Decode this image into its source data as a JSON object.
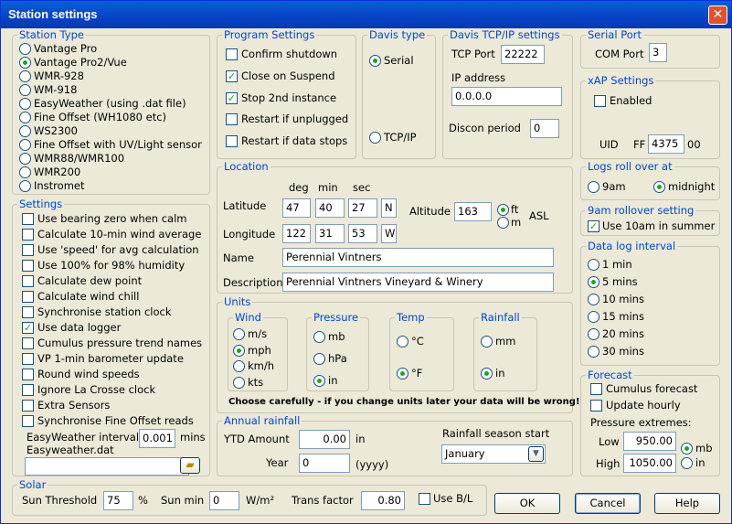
{
  "window": {
    "title": "Station settings",
    "close_glyph": "✕"
  },
  "station_type": {
    "legend": "Station Type",
    "options": [
      "Vantage Pro",
      "Vantage Pro2/Vue",
      "WMR-928",
      "WM-918",
      "EasyWeather (using .dat file)",
      "Fine Offset (WH1080 etc)",
      "WS2300",
      "Fine Offset with UV/Light sensor",
      "WMR88/WMR100",
      "WMR200",
      "Instromet"
    ],
    "selected": 1
  },
  "settings": {
    "legend": "Settings",
    "items": [
      {
        "label": "Use bearing zero when calm",
        "checked": false
      },
      {
        "label": "Calculate 10-min wind average",
        "checked": false
      },
      {
        "label": "Use 'speed' for avg calculation",
        "checked": false
      },
      {
        "label": "Use 100% for 98% humidity",
        "checked": false
      },
      {
        "label": "Calculate dew point",
        "checked": false
      },
      {
        "label": "Calculate wind chill",
        "checked": false
      },
      {
        "label": "Synchronise station clock",
        "checked": false
      },
      {
        "label": "Use data logger",
        "checked": true
      },
      {
        "label": "Cumulus pressure trend names",
        "checked": false
      },
      {
        "label": "VP 1-min barometer update",
        "checked": false
      },
      {
        "label": "Round wind speeds",
        "checked": false
      },
      {
        "label": "Ignore La Crosse clock",
        "checked": false
      },
      {
        "label": "Extra Sensors",
        "checked": false
      },
      {
        "label": "Synchronise Fine Offset reads",
        "checked": false
      }
    ],
    "easyweather_label": "EasyWeather interval",
    "easyweather_value": "0.001",
    "mins": "mins",
    "dat_label": "Easyweather.dat",
    "dat_value": ""
  },
  "program": {
    "legend": "Program Settings",
    "items": [
      {
        "label": "Confirm shutdown",
        "checked": false
      },
      {
        "label": "Close on Suspend",
        "checked": true
      },
      {
        "label": "Stop 2nd instance",
        "checked": true
      },
      {
        "label": "Restart if unplugged",
        "checked": false
      },
      {
        "label": "Restart if data stops",
        "checked": false
      }
    ]
  },
  "davis_type": {
    "legend": "Davis type",
    "serial": "Serial",
    "tcpip": "TCP/IP",
    "selected": "serial"
  },
  "davis_tcp": {
    "legend": "Davis TCP/IP settings",
    "tcp_port_label": "TCP Port",
    "tcp_port": "22222",
    "ip_label": "IP address",
    "ip": "0.0.0.0",
    "discon_label": "Discon period",
    "discon": "0"
  },
  "serial_port": {
    "legend": "Serial Port",
    "com_label": "COM Port",
    "com": "3"
  },
  "xap": {
    "legend": "xAP Settings",
    "enabled_label": "Enabled",
    "enabled": false,
    "uid_label": "UID",
    "ff": "FF",
    "uid": "4375",
    "suffix": "00"
  },
  "location": {
    "legend": "Location",
    "deg": "deg",
    "min": "min",
    "sec": "sec",
    "lat_label": "Latitude",
    "lat": [
      "47",
      "40",
      "27",
      "N"
    ],
    "lon_label": "Longitude",
    "lon": [
      "122",
      "31",
      "53",
      "W"
    ],
    "alt_label": "Altitude",
    "alt": "163",
    "ft": "ft",
    "m": "m",
    "asl": "ASL",
    "alt_unit": "ft",
    "name_label": "Name",
    "name": "Perennial Vintners",
    "desc_label": "Description",
    "desc": "Perennial Vintners Vineyard & Winery"
  },
  "units": {
    "legend": "Units",
    "wind": {
      "legend": "Wind",
      "options": [
        "m/s",
        "mph",
        "km/h",
        "kts"
      ],
      "selected": 1
    },
    "pressure": {
      "legend": "Pressure",
      "options": [
        "mb",
        "hPa",
        "in"
      ],
      "selected": 2
    },
    "temp": {
      "legend": "Temp",
      "options": [
        "°C",
        "°F"
      ],
      "selected": 1
    },
    "rainfall": {
      "legend": "Rainfall",
      "options": [
        "mm",
        "in"
      ],
      "selected": 1
    },
    "warning": "Choose carefully - if you change units later your data will be wrong!"
  },
  "annual": {
    "legend": "Annual rainfall",
    "ytd_label": "YTD Amount",
    "ytd": "0.00",
    "in": "in",
    "year_label": "Year",
    "year": "0",
    "yyyy": "(yyyy)",
    "season_label": "Rainfall season start",
    "season": "January"
  },
  "logs_roll": {
    "legend": "Logs roll over at",
    "opt1": "9am",
    "opt2": "midnight",
    "selected": "midnight"
  },
  "nine_am": {
    "legend": "9am rollover setting",
    "label": "Use 10am in summer",
    "checked": true
  },
  "data_log": {
    "legend": "Data log interval",
    "options": [
      "1 min",
      "5 mins",
      "10 mins",
      "15 mins",
      "20 mins",
      "30 mins"
    ],
    "selected": 1
  },
  "forecast": {
    "legend": "Forecast",
    "cumulus_label": "Cumulus forecast",
    "cumulus": false,
    "hourly_label": "Update hourly",
    "hourly": false,
    "extremes_label": "Pressure extremes:",
    "low_label": "Low",
    "low": "950.00",
    "high_label": "High",
    "high": "1050.00",
    "mb": "mb",
    "in": "in",
    "unit": "mb"
  },
  "solar": {
    "legend": "Solar",
    "threshold_label": "Sun Threshold",
    "threshold": "75",
    "pct": "%",
    "sunmin_label": "Sun min",
    "sunmin": "0",
    "wm2": "W/m²",
    "trans_label": "Trans factor",
    "trans": "0.80",
    "usebl_label": "Use B/L",
    "usebl": false
  },
  "buttons": {
    "ok": "OK",
    "cancel": "Cancel",
    "help": "Help"
  }
}
